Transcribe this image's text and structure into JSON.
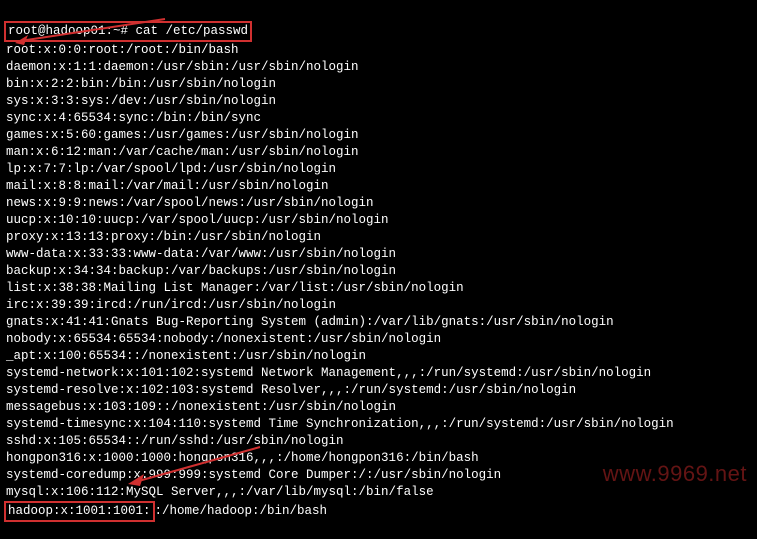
{
  "prompt": "root@hadoop01:~# cat /etc/passwd",
  "lines": [
    "root:x:0:0:root:/root:/bin/bash",
    "daemon:x:1:1:daemon:/usr/sbin:/usr/sbin/nologin",
    "bin:x:2:2:bin:/bin:/usr/sbin/nologin",
    "sys:x:3:3:sys:/dev:/usr/sbin/nologin",
    "sync:x:4:65534:sync:/bin:/bin/sync",
    "games:x:5:60:games:/usr/games:/usr/sbin/nologin",
    "man:x:6:12:man:/var/cache/man:/usr/sbin/nologin",
    "lp:x:7:7:lp:/var/spool/lpd:/usr/sbin/nologin",
    "mail:x:8:8:mail:/var/mail:/usr/sbin/nologin",
    "news:x:9:9:news:/var/spool/news:/usr/sbin/nologin",
    "uucp:x:10:10:uucp:/var/spool/uucp:/usr/sbin/nologin",
    "proxy:x:13:13:proxy:/bin:/usr/sbin/nologin",
    "www-data:x:33:33:www-data:/var/www:/usr/sbin/nologin",
    "backup:x:34:34:backup:/var/backups:/usr/sbin/nologin",
    "list:x:38:38:Mailing List Manager:/var/list:/usr/sbin/nologin",
    "irc:x:39:39:ircd:/run/ircd:/usr/sbin/nologin",
    "gnats:x:41:41:Gnats Bug-Reporting System (admin):/var/lib/gnats:/usr/sbin/nologin",
    "nobody:x:65534:65534:nobody:/nonexistent:/usr/sbin/nologin",
    "_apt:x:100:65534::/nonexistent:/usr/sbin/nologin",
    "systemd-network:x:101:102:systemd Network Management,,,:/run/systemd:/usr/sbin/nologin",
    "systemd-resolve:x:102:103:systemd Resolver,,,:/run/systemd:/usr/sbin/nologin",
    "messagebus:x:103:109::/nonexistent:/usr/sbin/nologin",
    "systemd-timesync:x:104:110:systemd Time Synchronization,,,:/run/systemd:/usr/sbin/nologin",
    "sshd:x:105:65534::/run/sshd:/usr/sbin/nologin",
    "hongpon316:x:1000:1000:hongpon316,,,:/home/hongpon316:/bin/bash",
    "systemd-coredump:x:999:999:systemd Core Dumper:/:/usr/sbin/nologin",
    "mysql:x:106:112:MySQL Server,,,:/var/lib/mysql:/bin/false"
  ],
  "last_line_highlight": "hadoop:x:1001:1001:",
  "last_line_rest": ":/home/hadoop:/bin/bash",
  "watermark": "www.9969.net"
}
